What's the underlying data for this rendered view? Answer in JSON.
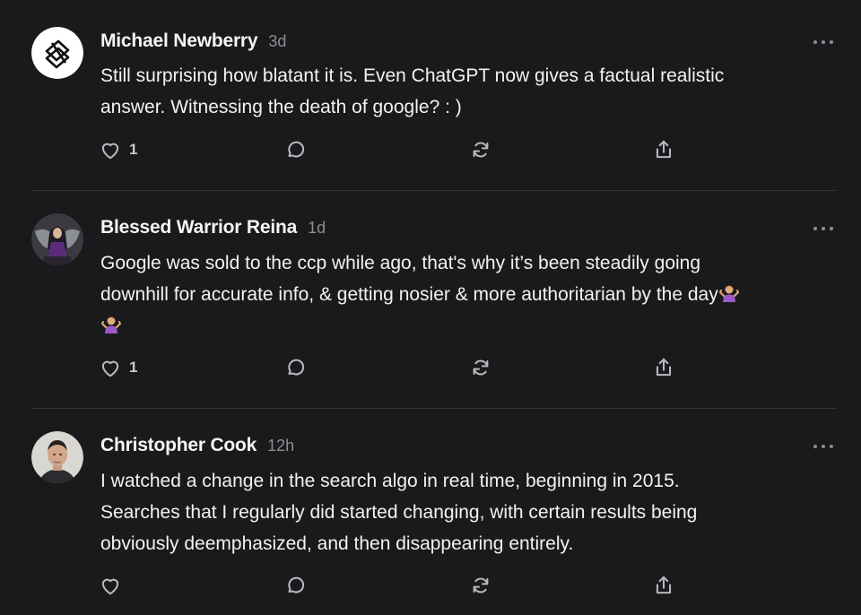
{
  "posts": [
    {
      "author": "Michael Newberry",
      "time": "3d",
      "avatar_icon": "abstract-logo-avatar",
      "body_lines": [
        "Still surprising how blatant it is. Even ChatGPT now gives a factual realistic",
        "answer. Witnessing the death of google? : )"
      ],
      "like_count": "1"
    },
    {
      "author": "Blessed Warrior Reina",
      "time": "1d",
      "avatar_icon": "warrior-avatar",
      "body_lines": [
        "Google was sold to the ccp while ago, that's why it’s been steadily going",
        "downhill for accurate info, & getting nosier & more authoritarian by the day"
      ],
      "emoji": "person-shrugging",
      "like_count": "1"
    },
    {
      "author": "Christopher Cook",
      "time": "12h",
      "avatar_icon": "portrait-avatar",
      "body_lines": [
        "I watched a change in the search algo in real time, beginning in 2015.",
        "Searches that I regularly did started changing, with certain results being",
        "obviously deemphasized, and then disappearing entirely."
      ],
      "like_count": ""
    }
  ],
  "icons": {
    "like": "heart-icon",
    "comment": "comment-bubble-icon",
    "repost": "repost-icon",
    "share": "share-icon",
    "more": "more-options-icon"
  },
  "colors": {
    "background": "#1a1a1d",
    "text": "#f2f2f2",
    "muted": "#8d8d92",
    "divider": "#333338"
  }
}
